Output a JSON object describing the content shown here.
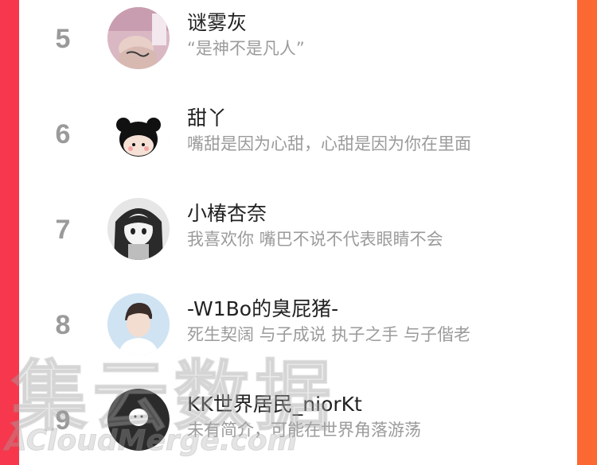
{
  "list": {
    "items": [
      {
        "rank": "5",
        "name": "谜雾灰",
        "signature": "“是神不是凡人”",
        "avatar": "photo-hand-avatar"
      },
      {
        "rank": "6",
        "name": "甜丫",
        "signature": "嘴甜是因为心甜，心甜是因为你在里面",
        "avatar": "cartoon-girl-avatar"
      },
      {
        "rank": "7",
        "name": "小椿杏奈",
        "signature": "我喜欢你 嘴巴不说不代表眼睛不会",
        "avatar": "manga-girl-avatar"
      },
      {
        "rank": "8",
        "name": "-W1Bo的臭屁猪-",
        "signature": "死生契阔 与子成说 执子之手 与子偕老",
        "avatar": "photo-boy-avatar"
      },
      {
        "rank": "9",
        "name": "KK世界居民_niorKt",
        "signature": "未有简介，可能在世界角落游荡",
        "avatar": "default-avatar"
      }
    ]
  },
  "watermark": {
    "text_cn": "集云数据",
    "text_en": "ACloudMerge.com"
  },
  "colors": {
    "background_left": "#f7374d",
    "background_right": "#fb6a32",
    "rank": "#9a9a9a",
    "name": "#222222",
    "signature": "#9b9b9b"
  }
}
